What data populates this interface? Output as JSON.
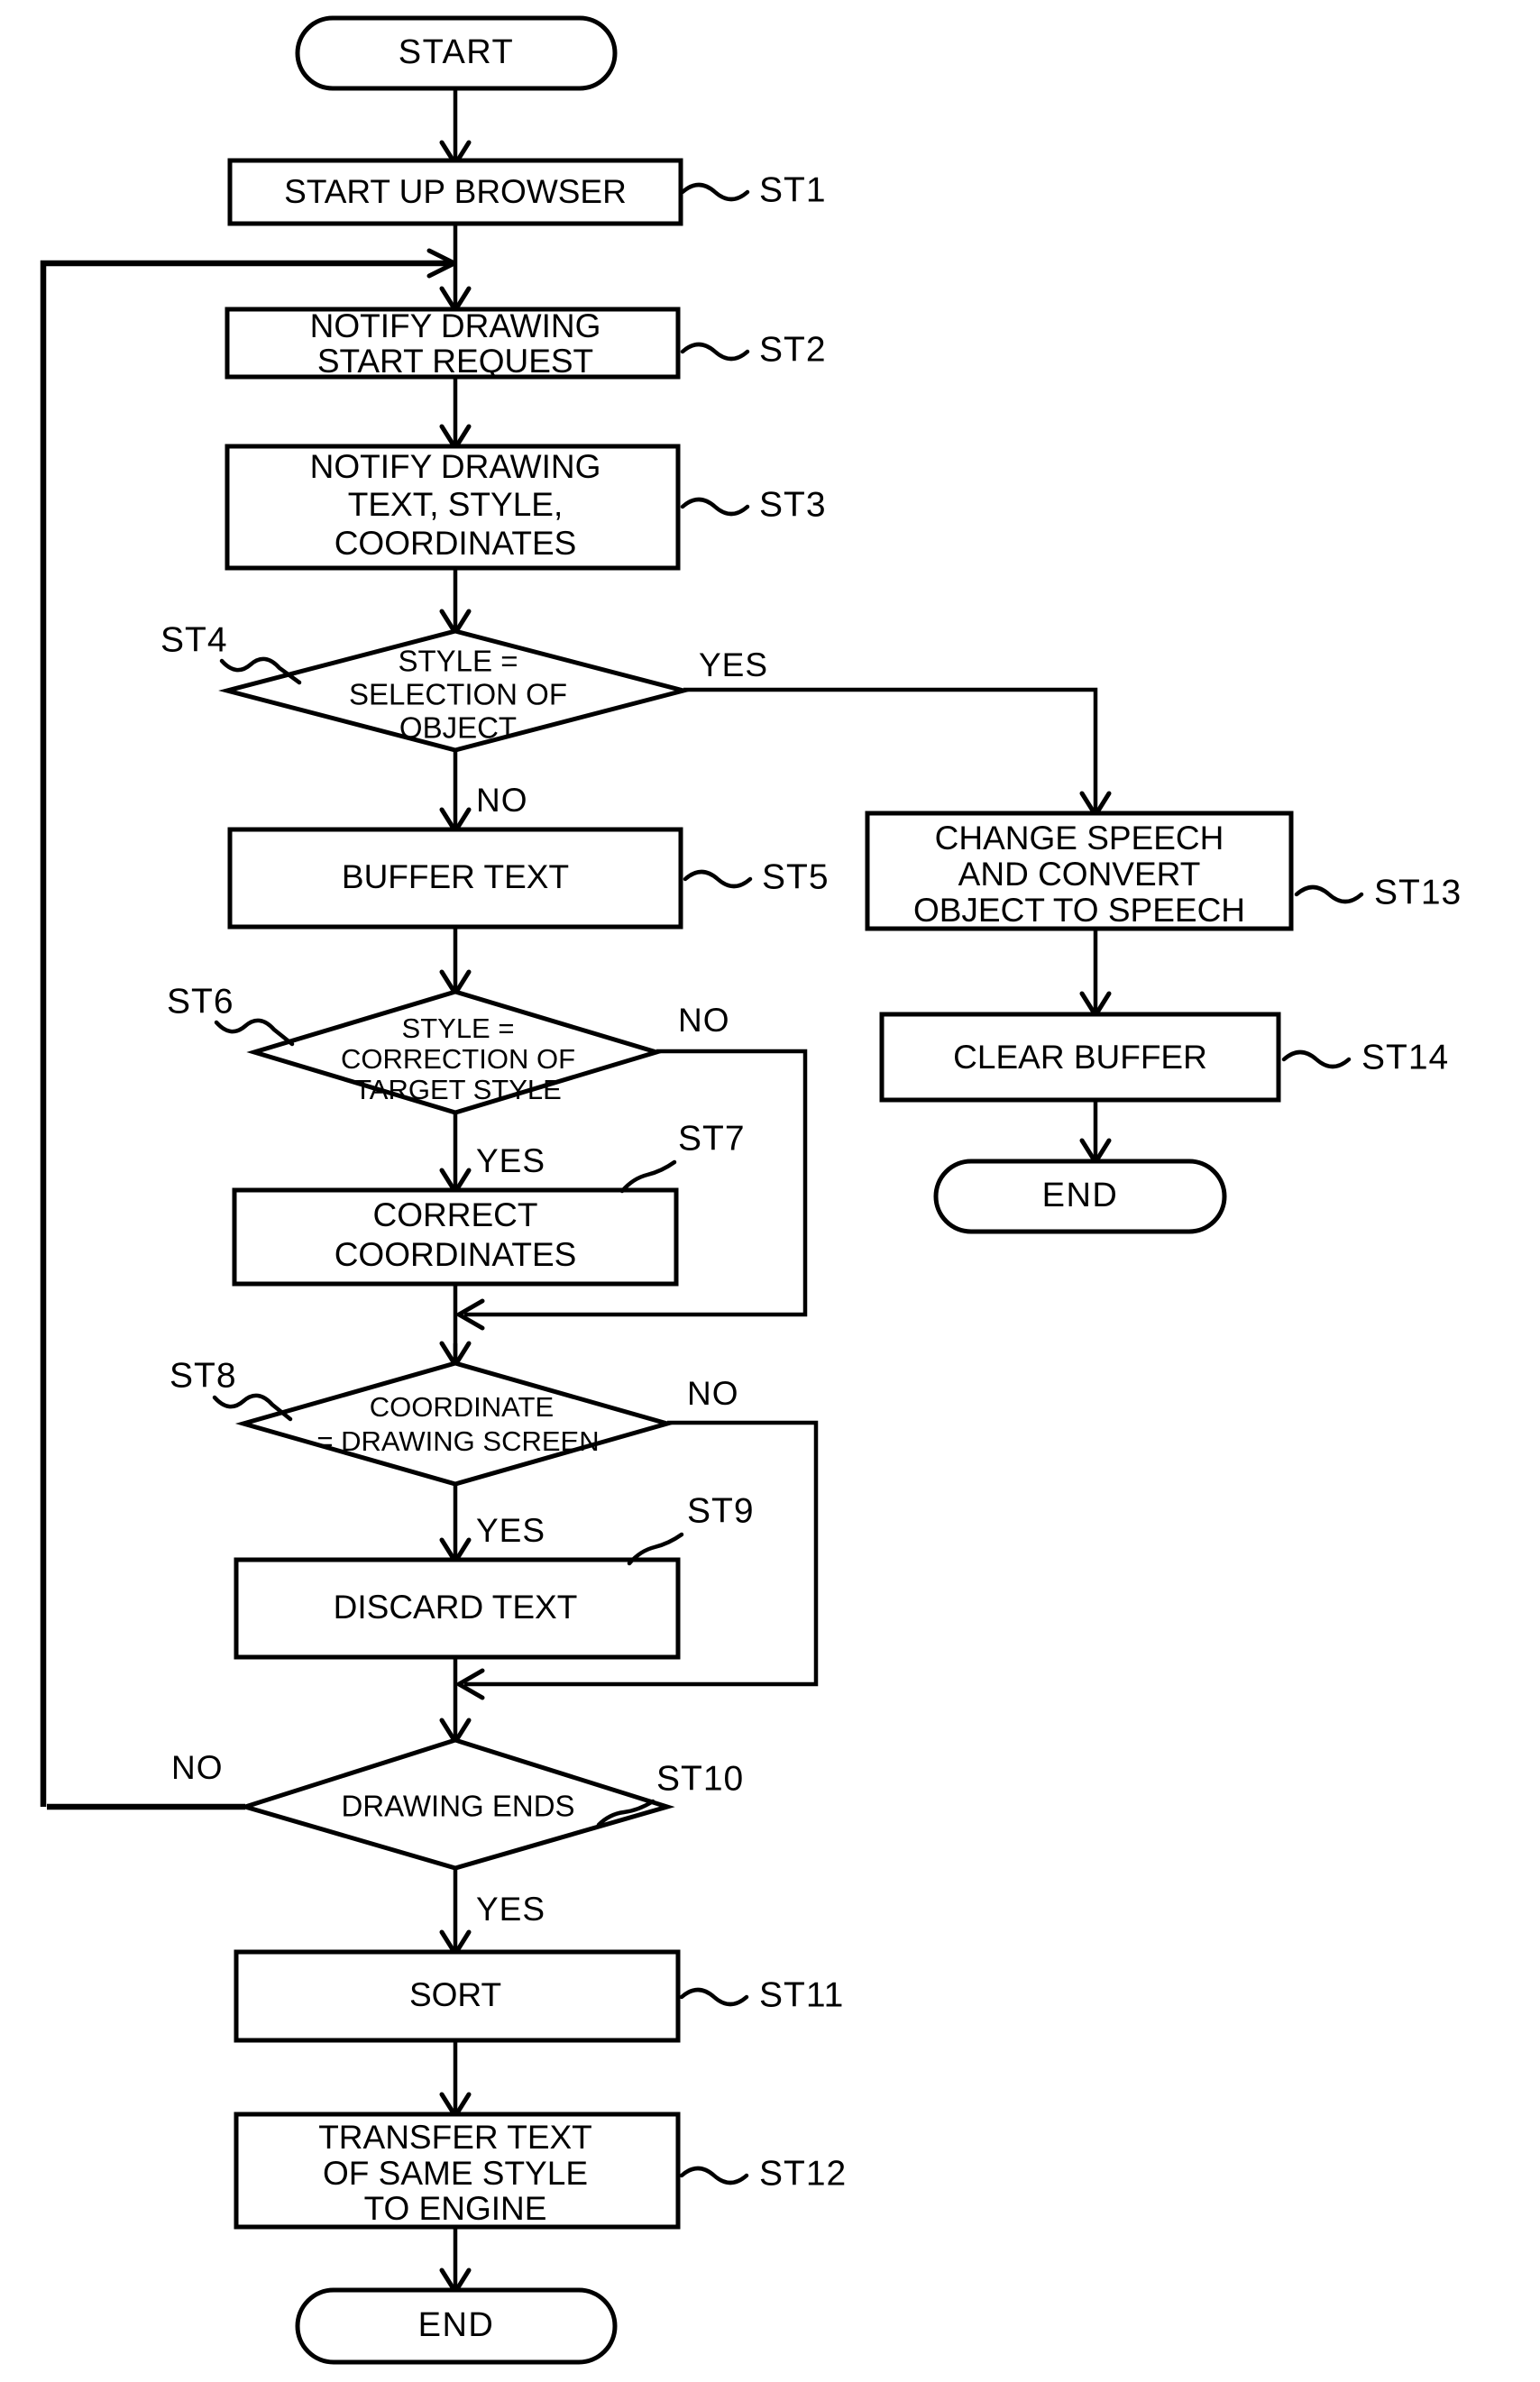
{
  "diagram": {
    "type": "flowchart",
    "title": "",
    "nodes": [
      {
        "id": "start",
        "kind": "terminator",
        "label": "START",
        "tag": ""
      },
      {
        "id": "st1",
        "kind": "process",
        "label": "START UP BROWSER",
        "tag": "ST1"
      },
      {
        "id": "st2",
        "kind": "process",
        "lines": [
          "NOTIFY DRAWING",
          "START REQUEST"
        ],
        "tag": "ST2"
      },
      {
        "id": "st3",
        "kind": "process",
        "lines": [
          "NOTIFY DRAWING",
          "TEXT, STYLE,",
          "COORDINATES"
        ],
        "tag": "ST3"
      },
      {
        "id": "st4",
        "kind": "decision",
        "lines": [
          "STYLE =",
          "SELECTION OF",
          "OBJECT"
        ],
        "tag": "ST4"
      },
      {
        "id": "st5",
        "kind": "process",
        "label": "BUFFER TEXT",
        "tag": "ST5"
      },
      {
        "id": "st6",
        "kind": "decision",
        "lines": [
          "STYLE =",
          "CORRECTION OF",
          "TARGET STYLE"
        ],
        "tag": "ST6"
      },
      {
        "id": "st7",
        "kind": "process",
        "lines": [
          "CORRECT",
          "COORDINATES"
        ],
        "tag": "ST7"
      },
      {
        "id": "st8",
        "kind": "decision",
        "lines": [
          "COORDINATE",
          "= DRAWING SCREEN"
        ],
        "tag": "ST8"
      },
      {
        "id": "st9",
        "kind": "process",
        "label": "DISCARD TEXT",
        "tag": "ST9"
      },
      {
        "id": "st10",
        "kind": "decision",
        "label": "DRAWING ENDS",
        "tag": "ST10"
      },
      {
        "id": "st11",
        "kind": "process",
        "label": "SORT",
        "tag": "ST11"
      },
      {
        "id": "st12",
        "kind": "process",
        "lines": [
          "TRANSFER TEXT",
          "OF SAME STYLE",
          "TO ENGINE"
        ],
        "tag": "ST12"
      },
      {
        "id": "end1",
        "kind": "terminator",
        "label": "END",
        "tag": ""
      },
      {
        "id": "st13",
        "kind": "process",
        "lines": [
          "CHANGE SPEECH",
          "AND CONVERT",
          "OBJECT TO SPEECH"
        ],
        "tag": "ST13"
      },
      {
        "id": "st14",
        "kind": "process",
        "label": "CLEAR BUFFER",
        "tag": "ST14"
      },
      {
        "id": "end2",
        "kind": "terminator",
        "label": "END",
        "tag": ""
      }
    ],
    "branch_labels": {
      "st4_yes": "YES",
      "st4_no": "NO",
      "st6_no": "NO",
      "st6_yes": "YES",
      "st8_no": "NO",
      "st8_yes": "YES",
      "st10_no": "NO",
      "st10_yes": "YES"
    },
    "text": {
      "start": "START",
      "st1": "START UP BROWSER",
      "st2_l1": "NOTIFY DRAWING",
      "st2_l2": "START REQUEST",
      "st3_l1": "NOTIFY DRAWING",
      "st3_l2": "TEXT, STYLE,",
      "st3_l3": "COORDINATES",
      "st4_l1": "STYLE =",
      "st4_l2": "SELECTION OF",
      "st4_l3": "OBJECT",
      "st5": "BUFFER TEXT",
      "st6_l1": "STYLE =",
      "st6_l2": "CORRECTION OF",
      "st6_l3": "TARGET STYLE",
      "st7_l1": "CORRECT",
      "st7_l2": "COORDINATES",
      "st8_l1": "COORDINATE",
      "st8_l2": "= DRAWING SCREEN",
      "st9": "DISCARD TEXT",
      "st10": "DRAWING ENDS",
      "st11": "SORT",
      "st12_l1": "TRANSFER TEXT",
      "st12_l2": "OF SAME STYLE",
      "st12_l3": "TO ENGINE",
      "end_bottom": "END",
      "st13_l1": "CHANGE SPEECH",
      "st13_l2": "AND CONVERT",
      "st13_l3": "OBJECT TO SPEECH",
      "st14": "CLEAR BUFFER",
      "end_right": "END"
    },
    "tags": {
      "st1": "ST1",
      "st2": "ST2",
      "st3": "ST3",
      "st4": "ST4",
      "st5": "ST5",
      "st6": "ST6",
      "st7": "ST7",
      "st8": "ST8",
      "st9": "ST9",
      "st10": "ST10",
      "st11": "ST11",
      "st12": "ST12",
      "st13": "ST13",
      "st14": "ST14"
    },
    "colors": {
      "stroke": "#000000",
      "fill": "#ffffff",
      "background": "#ffffff"
    }
  }
}
